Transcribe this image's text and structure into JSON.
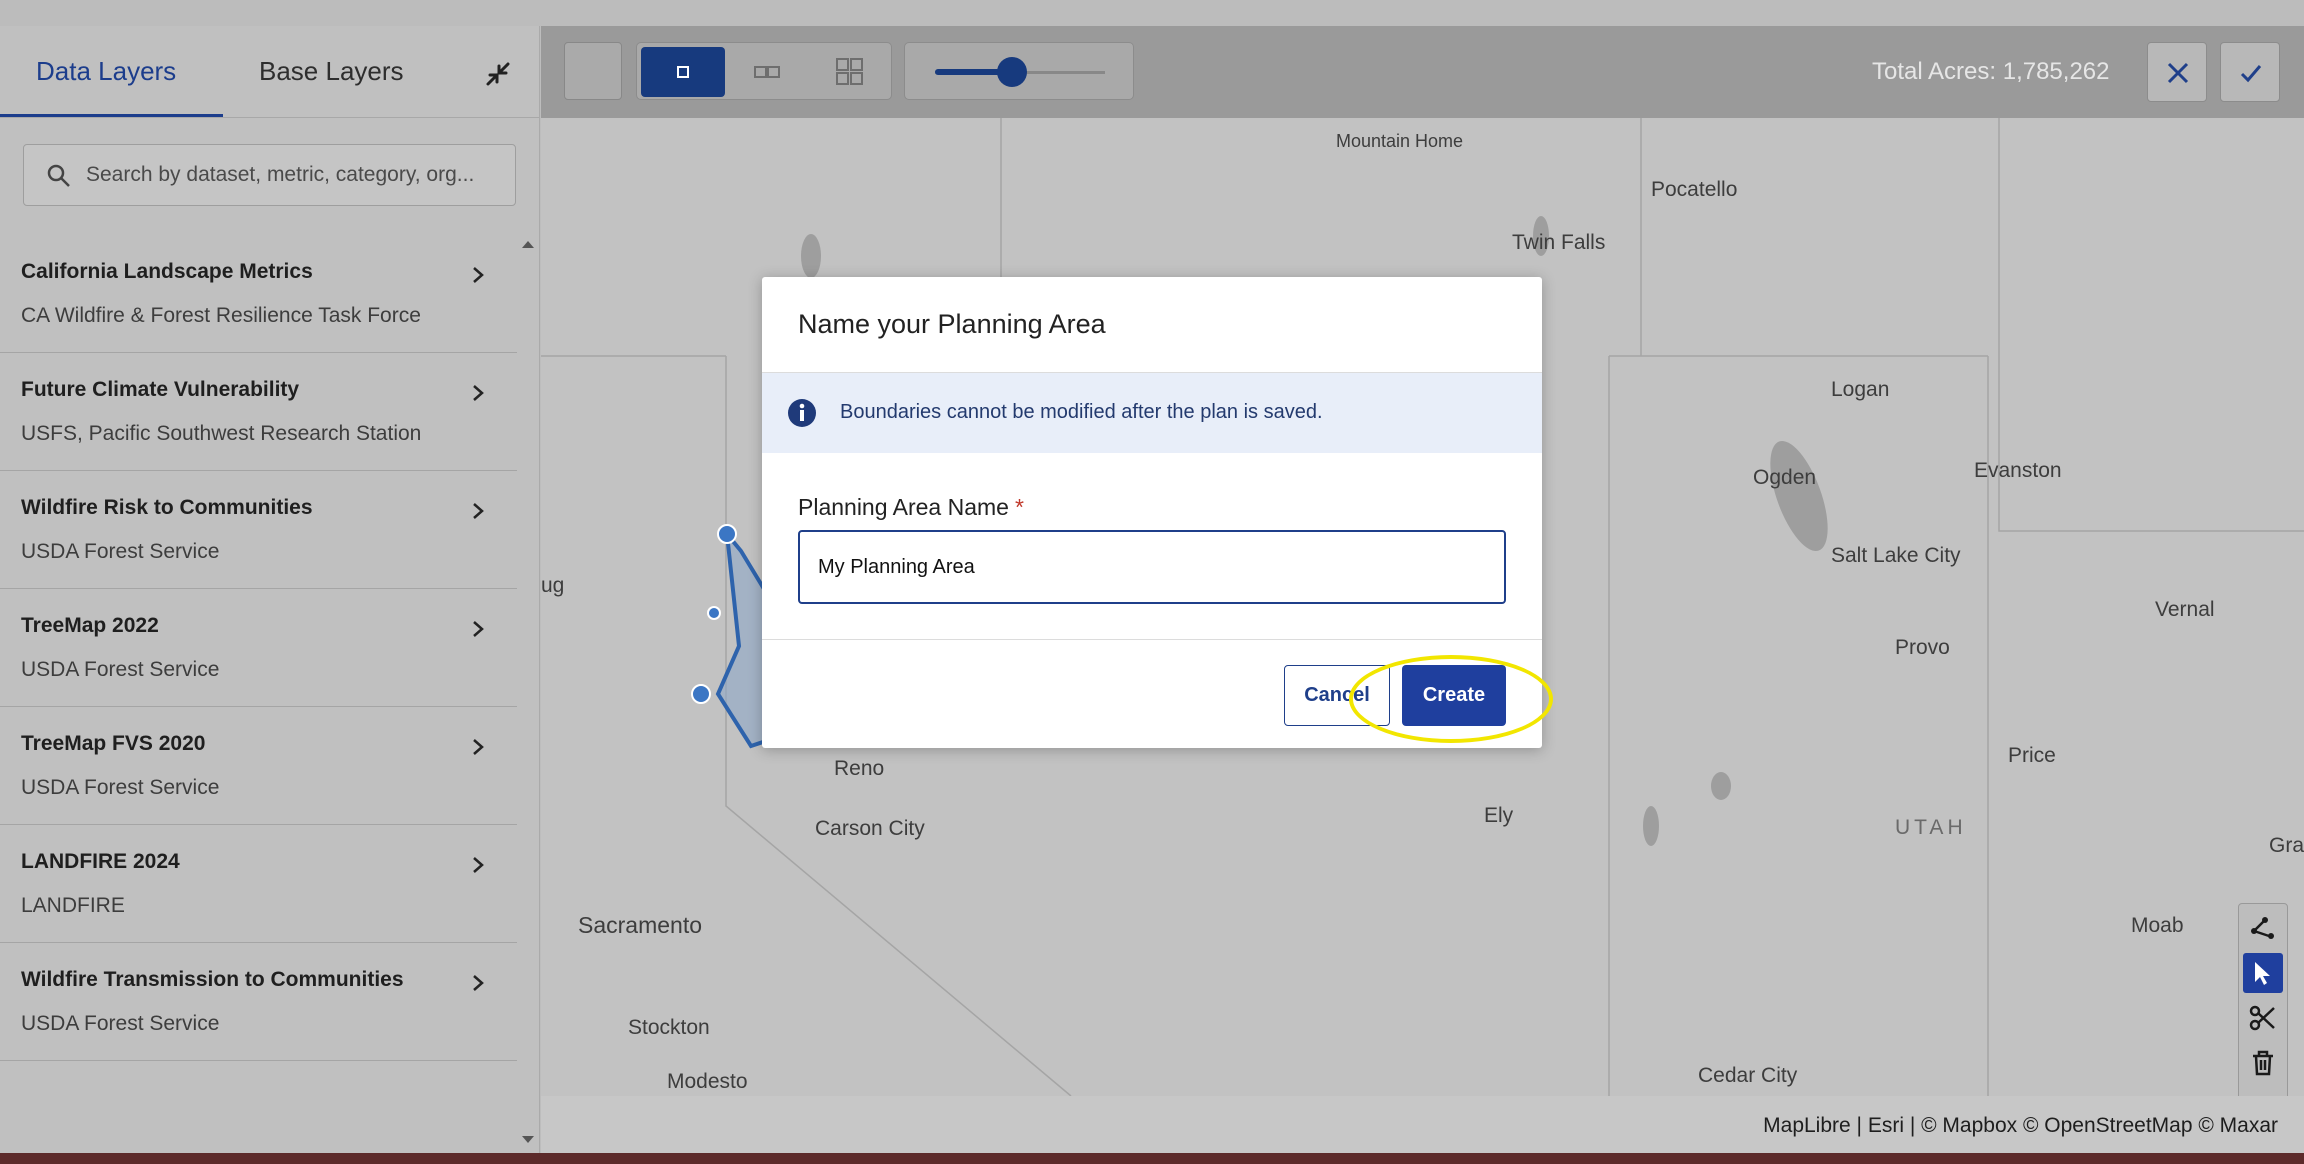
{
  "sidebar": {
    "tabs": [
      {
        "label": "Data Layers"
      },
      {
        "label": "Base Layers"
      }
    ],
    "search_placeholder": "Search by dataset, metric, category, org...",
    "items": [
      {
        "title": "California Landscape Metrics",
        "subtitle": "CA Wildfire & Forest Resilience Task Force"
      },
      {
        "title": "Future Climate Vulnerability",
        "subtitle": "USFS, Pacific Southwest Research Station"
      },
      {
        "title": "Wildfire Risk to Communities",
        "subtitle": "USDA Forest Service"
      },
      {
        "title": "TreeMap 2022",
        "subtitle": "USDA Forest Service"
      },
      {
        "title": "TreeMap FVS 2020",
        "subtitle": "USDA Forest Service"
      },
      {
        "title": "LANDFIRE 2024",
        "subtitle": "LANDFIRE"
      },
      {
        "title": "Wildfire Transmission to Communities",
        "subtitle": "USDA Forest Service"
      }
    ]
  },
  "toolbar": {
    "opacity_fraction": 0.45,
    "total_acres": "Total Acres: 1,785,262"
  },
  "map": {
    "labels": {
      "mountain_home": "Mountain Home",
      "pocatello": "Pocatello",
      "twin_falls": "Twin Falls",
      "logan": "Logan",
      "ogden": "Ogden",
      "evanston": "Evanston",
      "salt_lake_city": "Salt Lake City",
      "vernal": "Vernal",
      "provo": "Provo",
      "price": "Price",
      "utah": "UTAH",
      "grand": "Grand",
      "moab": "Moab",
      "ely": "Ely",
      "reno": "Reno",
      "carson_city": "Carson City",
      "sacramento": "Sacramento",
      "stockton": "Stockton",
      "modesto": "Modesto",
      "cedar_city": "Cedar City",
      "ug": "ug"
    },
    "attribution": "MapLibre | Esri | © Mapbox © OpenStreetMap  © Maxar"
  },
  "modal": {
    "title": "Name your Planning Area",
    "info": "Boundaries cannot be modified after the plan is saved.",
    "field_label": "Planning Area Name",
    "required_mark": "*",
    "field_value": "My Planning Area",
    "cancel_label": "Cancel",
    "create_label": "Create"
  },
  "colors": {
    "accent": "#1f3f9e",
    "highlight": "#f2e600"
  }
}
